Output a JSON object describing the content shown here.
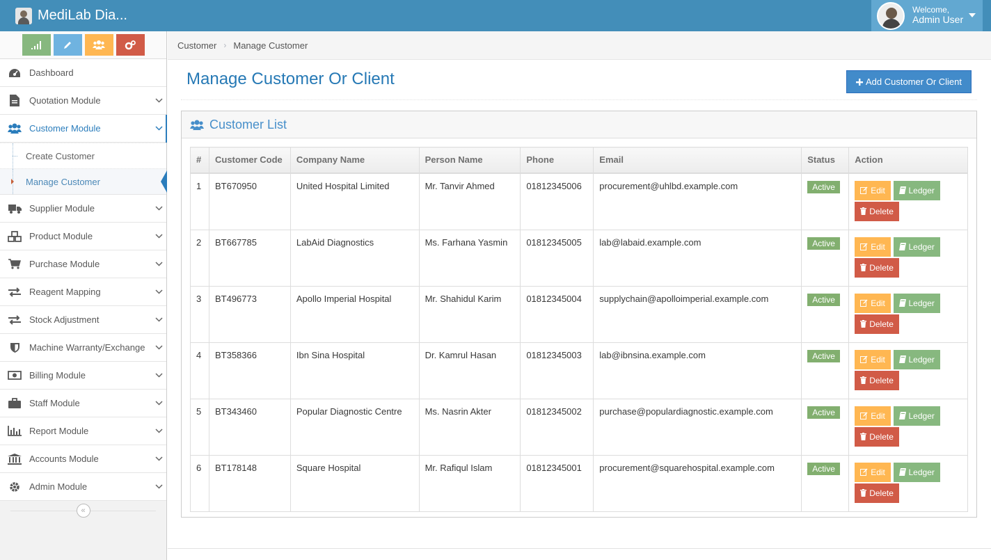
{
  "app": {
    "title": "MediLab Dia..."
  },
  "user": {
    "welcome": "Welcome,",
    "name": "Admin User"
  },
  "sidebar": {
    "items": [
      {
        "label": "Dashboard",
        "icon": "dashboard-icon"
      },
      {
        "label": "Quotation Module",
        "icon": "file-icon"
      },
      {
        "label": "Customer Module",
        "icon": "users-icon"
      },
      {
        "label": "Supplier Module",
        "icon": "truck-icon"
      },
      {
        "label": "Product Module",
        "icon": "cubes-icon"
      },
      {
        "label": "Purchase Module",
        "icon": "cart-icon"
      },
      {
        "label": "Reagent Mapping",
        "icon": "exchange-icon"
      },
      {
        "label": "Stock Adjustment",
        "icon": "exchange-icon"
      },
      {
        "label": "Machine Warranty/Exchange",
        "icon": "shield-icon"
      },
      {
        "label": "Billing Module",
        "icon": "money-icon"
      },
      {
        "label": "Staff Module",
        "icon": "briefcase-icon"
      },
      {
        "label": "Report Module",
        "icon": "bar-chart-icon"
      },
      {
        "label": "Accounts Module",
        "icon": "bank-icon"
      },
      {
        "label": "Admin Module",
        "icon": "cog-icon"
      }
    ],
    "customer_sub": [
      "Create Customer",
      "Manage Customer"
    ]
  },
  "breadcrumb": [
    "Customer",
    "Manage Customer"
  ],
  "page": {
    "title": "Manage Customer Or Client",
    "add_button": "Add Customer Or Client"
  },
  "widget": {
    "title": "Customer List"
  },
  "table": {
    "headers": [
      "#",
      "Customer Code",
      "Company Name",
      "Person Name",
      "Phone",
      "Email",
      "Status",
      "Action"
    ],
    "rows": [
      [
        "1",
        "BT670950",
        "United Hospital Limited",
        "Mr. Tanvir Ahmed",
        "01812345006",
        "procurement@uhlbd.example.com",
        "Active"
      ],
      [
        "2",
        "BT667785",
        "LabAid Diagnostics",
        "Ms. Farhana Yasmin",
        "01812345005",
        "lab@labaid.example.com",
        "Active"
      ],
      [
        "3",
        "BT496773",
        "Apollo Imperial Hospital",
        "Mr. Shahidul Karim",
        "01812345004",
        "supplychain@apolloimperial.example.com",
        "Active"
      ],
      [
        "4",
        "BT358366",
        "Ibn Sina Hospital",
        "Dr. Kamrul Hasan",
        "01812345003",
        "lab@ibnsina.example.com",
        "Active"
      ],
      [
        "5",
        "BT343460",
        "Popular Diagnostic Centre",
        "Ms. Nasrin Akter",
        "01812345002",
        "purchase@populardiagnostic.example.com",
        "Active"
      ],
      [
        "6",
        "BT178148",
        "Square Hospital",
        "Mr. Rafiqul Islam",
        "01812345001",
        "procurement@squarehospital.example.com",
        "Active"
      ]
    ],
    "actions": {
      "edit": "Edit",
      "ledger": "Ledger",
      "delete": "Delete"
    }
  }
}
